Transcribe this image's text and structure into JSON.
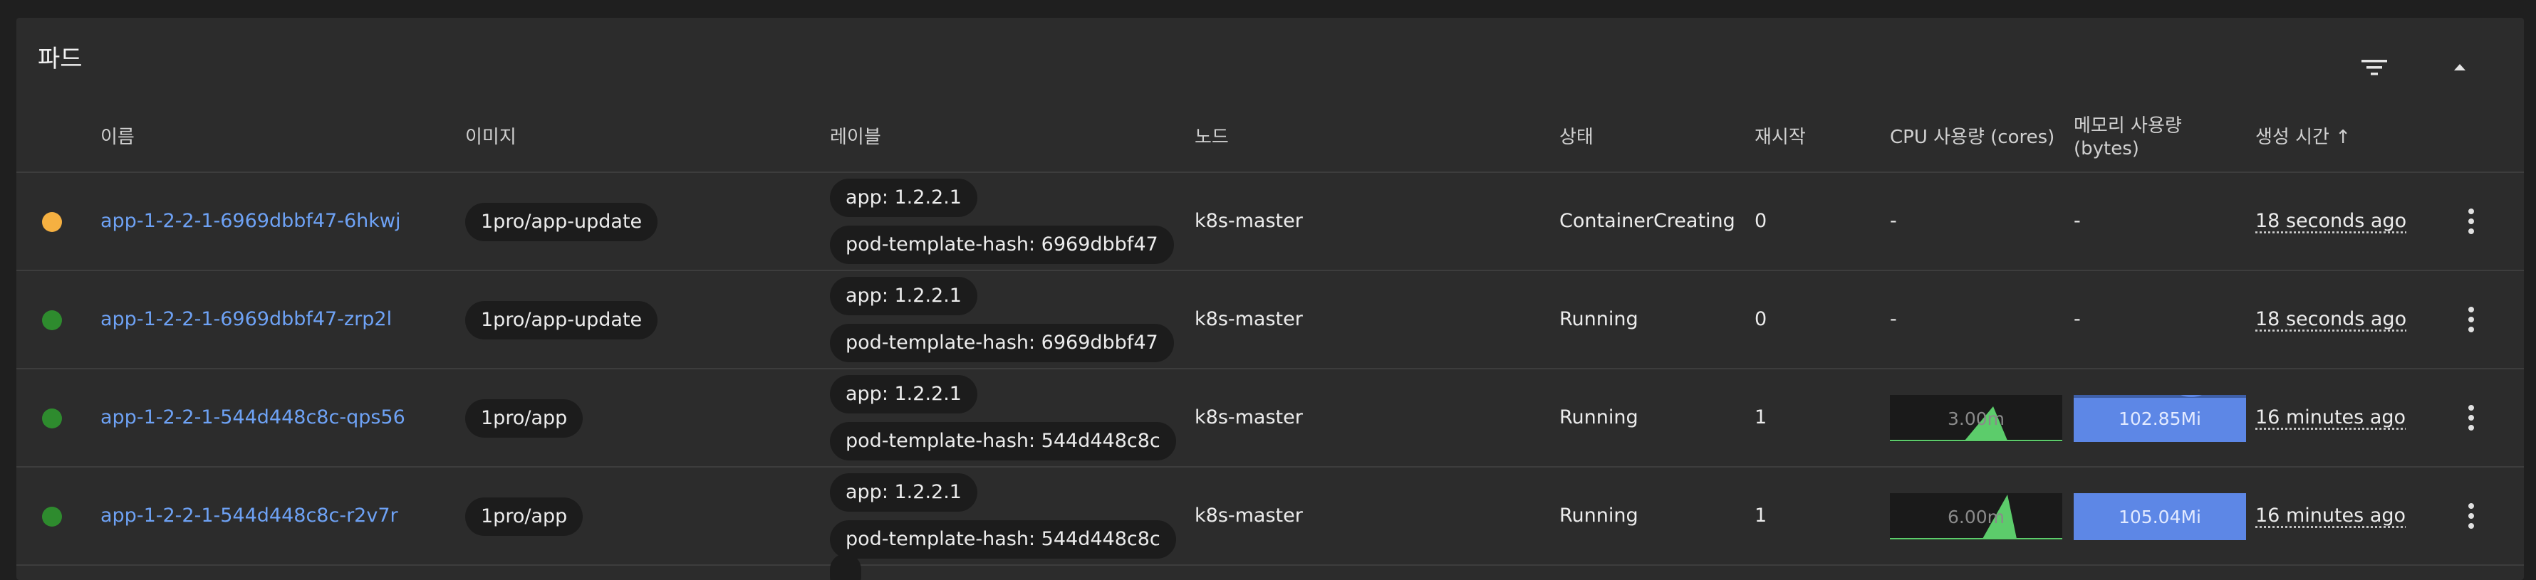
{
  "card": {
    "title": "파드"
  },
  "columns": {
    "name": "이름",
    "image": "이미지",
    "labels": "레이블",
    "node": "노드",
    "status": "상태",
    "restarts": "재시작",
    "cpu": "CPU 사용량 (cores)",
    "memory_line1": "메모리 사용량",
    "memory_line2": "(bytes)",
    "created": "생성 시간 ↑"
  },
  "icons": {
    "filter": "filter-icon",
    "collapse": "chevron-up-icon",
    "row_menu": "more-vert-icon"
  },
  "colors": {
    "pending": "#f5b041",
    "running": "#2e8b2e",
    "link": "#6ea2f5",
    "cpu_fill": "#5ccc6b",
    "mem_fill": "#5d87e6"
  },
  "pods": [
    {
      "status_color": "pending",
      "name": "app-1-2-2-1-6969dbbf47-6hkwj",
      "image": "1pro/app-update",
      "label_app": "app: 1.2.2.1",
      "label_hash": "pod-template-hash: 6969dbbf47",
      "node": "k8s-master",
      "status": "ContainerCreating",
      "restarts": "0",
      "cpu": "-",
      "memory": "-",
      "created": "18 seconds ago"
    },
    {
      "status_color": "running",
      "name": "app-1-2-2-1-6969dbbf47-zrp2l",
      "image": "1pro/app-update",
      "label_app": "app: 1.2.2.1",
      "label_hash": "pod-template-hash: 6969dbbf47",
      "node": "k8s-master",
      "status": "Running",
      "restarts": "0",
      "cpu": "-",
      "memory": "-",
      "created": "18 seconds ago"
    },
    {
      "status_color": "running",
      "name": "app-1-2-2-1-544d448c8c-qps56",
      "image": "1pro/app",
      "label_app": "app: 1.2.2.1",
      "label_hash": "pod-template-hash: 544d448c8c",
      "node": "k8s-master",
      "status": "Running",
      "restarts": "1",
      "cpu": "3.00m",
      "memory": "102.85Mi",
      "created": "16 minutes ago"
    },
    {
      "status_color": "running",
      "name": "app-1-2-2-1-544d448c8c-r2v7r",
      "image": "1pro/app",
      "label_app": "app: 1.2.2.1",
      "label_hash": "pod-template-hash: 544d448c8c",
      "node": "k8s-master",
      "status": "Running",
      "restarts": "1",
      "cpu": "6.00m",
      "memory": "105.04Mi",
      "created": "16 minutes ago"
    }
  ]
}
